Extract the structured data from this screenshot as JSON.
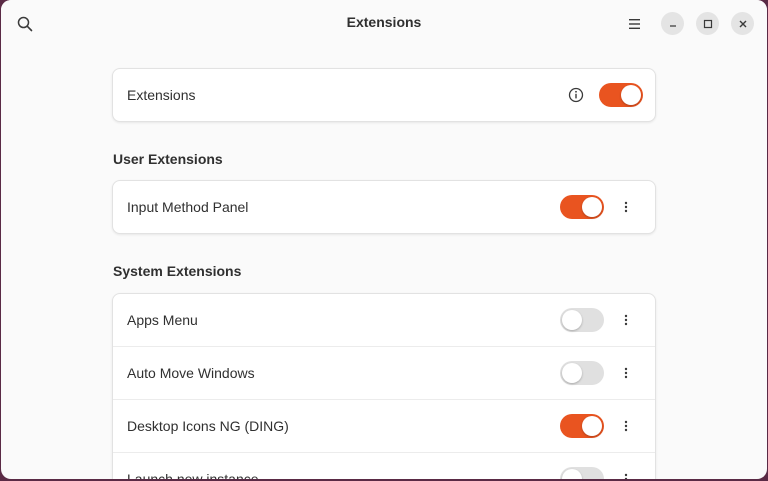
{
  "window": {
    "title": "Extensions"
  },
  "master": {
    "label": "Extensions",
    "enabled": true
  },
  "user_section": {
    "title": "User Extensions",
    "items": [
      {
        "label": "Input Method Panel",
        "enabled": true
      }
    ]
  },
  "system_section": {
    "title": "System Extensions",
    "items": [
      {
        "label": "Apps Menu",
        "enabled": false
      },
      {
        "label": "Auto Move Windows",
        "enabled": false
      },
      {
        "label": "Desktop Icons NG (DING)",
        "enabled": true
      },
      {
        "label": "Launch new instance",
        "enabled": false
      }
    ]
  },
  "colors": {
    "accent": "#e95420",
    "toggle_off": "#e0e0e0"
  }
}
